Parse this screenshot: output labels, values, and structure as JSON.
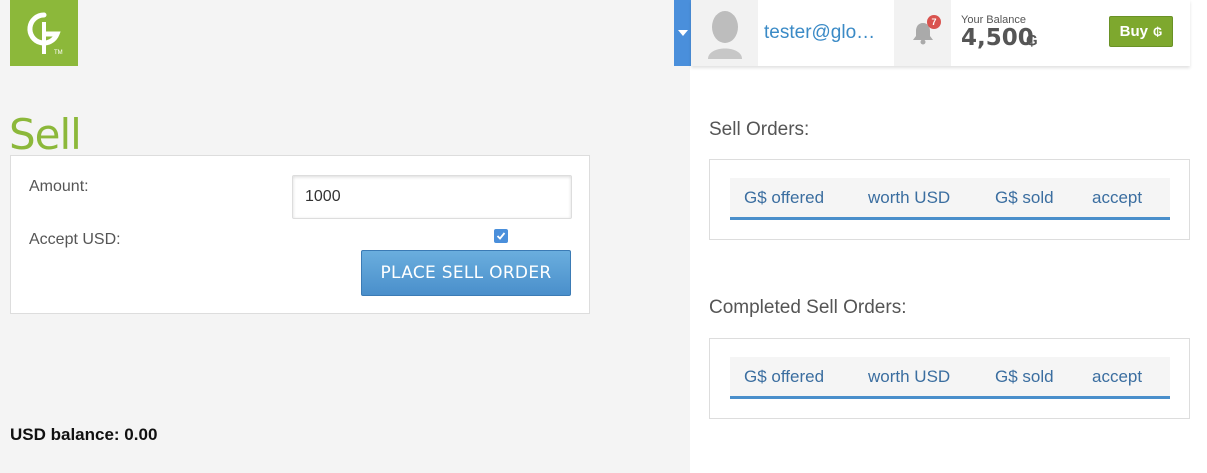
{
  "colors": {
    "brand_green": "#8cb83a",
    "accent_blue": "#4a8fdb",
    "link_blue": "#3a8ac6"
  },
  "header": {
    "user_email": "tester@glo…",
    "notification_count": "7",
    "balance_label": "Your Balance",
    "balance_value": "4,500",
    "currency_symbol": "₲",
    "buy_label": "Buy",
    "buy_symbol": "₲"
  },
  "sell": {
    "title": "Sell",
    "amount_label": "Amount:",
    "amount_value": "1000",
    "accept_usd_label": "Accept USD:",
    "accept_usd_checked": true,
    "place_order_label": "PLACE SELL ORDER",
    "usd_balance": "USD balance: 0.00"
  },
  "sell_orders": {
    "title": "Sell Orders:",
    "columns": [
      "G$ offered",
      "worth USD",
      "G$ sold",
      "accept"
    ]
  },
  "completed_orders": {
    "title": "Completed Sell Orders:",
    "columns": [
      "G$ offered",
      "worth USD",
      "G$ sold",
      "accept"
    ]
  }
}
